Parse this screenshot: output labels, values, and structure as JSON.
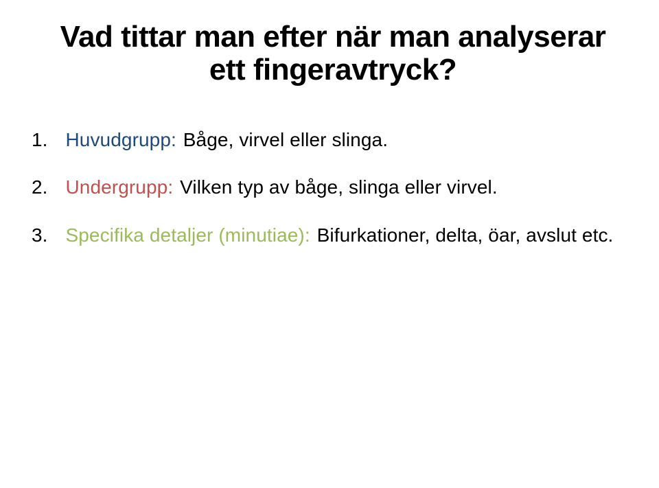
{
  "title": {
    "line1": "Vad tittar man efter när man analyserar",
    "line2": "ett fingeravtryck?"
  },
  "items": [
    {
      "num": "1.",
      "label": "Huvudgrupp:",
      "desc": "Båge, virvel eller slinga."
    },
    {
      "num": "2.",
      "label": "Undergrupp:",
      "desc": "Vilken typ av båge, slinga eller virvel."
    },
    {
      "num": "3.",
      "label": "Specifika detaljer (minutiae):",
      "desc": "Bifurkationer, delta, öar, avslut etc."
    }
  ]
}
